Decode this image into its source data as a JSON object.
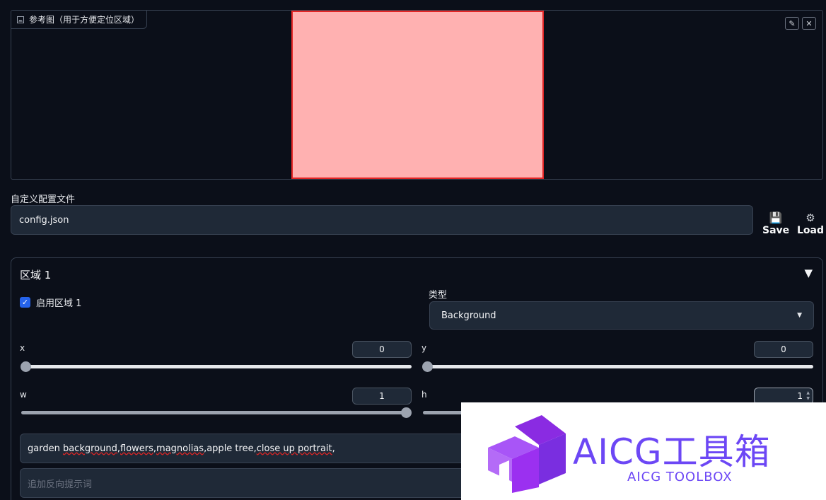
{
  "reference": {
    "label": "参考图（用于方便定位区域）",
    "edit_icon": "pencil-icon",
    "close_icon": "close-icon"
  },
  "config": {
    "label": "自定义配置文件",
    "value": "config.json",
    "save_label": "Save",
    "load_label": "Load",
    "save_icon": "floppy-disk-icon",
    "load_icon": "gear-icon"
  },
  "region": {
    "title": "区域 1",
    "toggle_icon": "triangle-down-icon",
    "enable_label": "启用区域 1",
    "enabled": true,
    "type_label": "类型",
    "type_value": "Background",
    "sliders": {
      "x": {
        "label": "x",
        "value": "0"
      },
      "y": {
        "label": "y",
        "value": "0"
      },
      "w": {
        "label": "w",
        "value": "1"
      },
      "h": {
        "label": "h",
        "value": "1"
      }
    },
    "prompt_pre": "garden ",
    "prompt_words": [
      "background",
      "flowers",
      "magnolias",
      "apple tree",
      "close up portrait"
    ],
    "prompt": "garden background,flowers,magnolias,apple tree,close up portrait,",
    "negative_placeholder": "追加反向提示词"
  },
  "watermark": {
    "title": "AICG工具箱",
    "subtitle": "AICG TOOLBOX"
  },
  "colors": {
    "background": "#0b0f19",
    "panel": "#1f2937",
    "border": "#374151",
    "accent": "#2563eb",
    "ref_fill": "#ffb1b1",
    "ref_border": "#e32525",
    "brand": "#6c47f5"
  }
}
